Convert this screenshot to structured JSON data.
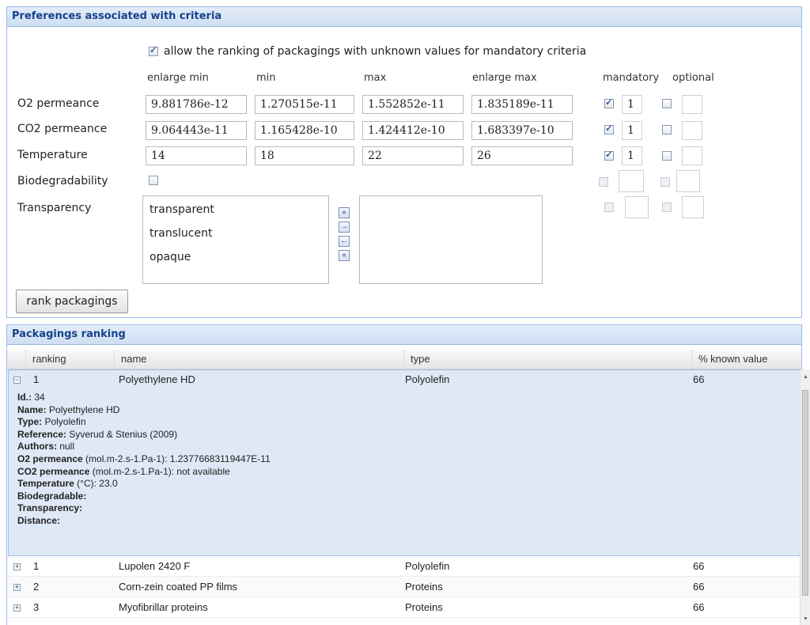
{
  "prefs": {
    "title": "Preferences associated with criteria",
    "allow_label": "allow the ranking of packagings with unknown values for mandatory criteria",
    "col_headers": [
      "enlarge min",
      "min",
      "max",
      "enlarge max",
      "mandatory",
      "optional"
    ],
    "rows": [
      {
        "label": "O2 permeance",
        "values": [
          "9.881786e-12",
          "1.270515e-11",
          "1.552852e-11",
          "1.835189e-11"
        ],
        "mandatory_checked": true,
        "mandatory_weight": "1",
        "optional_checked": false
      },
      {
        "label": "CO2 permeance",
        "values": [
          "9.064443e-11",
          "1.165428e-10",
          "1.424412e-10",
          "1.683397e-10"
        ],
        "mandatory_checked": true,
        "mandatory_weight": "1",
        "optional_checked": false
      },
      {
        "label": "Temperature",
        "values": [
          "14",
          "18",
          "22",
          "26"
        ],
        "mandatory_checked": true,
        "mandatory_weight": "1",
        "optional_checked": false
      }
    ],
    "biodegradability_label": "Biodegradability",
    "transparency_label": "Transparency",
    "transparency_options": [
      "transparent",
      "translucent",
      "opaque"
    ],
    "rank_button": "rank packagings"
  },
  "ranking": {
    "title": "Packagings ranking",
    "headers": [
      "ranking",
      "name",
      "type",
      "% known value"
    ],
    "expanded": {
      "rank": "1",
      "name": "Polyethylene HD",
      "type": "Polyolefin",
      "known": "66",
      "details": [
        {
          "k": "Id.:",
          "v": " 34"
        },
        {
          "k": "Name:",
          "v": " Polyethylene HD"
        },
        {
          "k": "Type:",
          "v": " Polyolefin"
        },
        {
          "k": "Reference:",
          "v": " Syverud & Stenius (2009)"
        },
        {
          "k": "Authors:",
          "v": " null"
        },
        {
          "k": "O2 permeance",
          "v": " (mol.m-2.s-1.Pa-1): 1.23776683119447E-11"
        },
        {
          "k": "CO2 permeance",
          "v": " (mol.m-2.s-1.Pa-1): not available"
        },
        {
          "k": "Temperature",
          "v": " (°C): 23.0"
        },
        {
          "k": "Biodegradable:",
          "v": ""
        },
        {
          "k": "Transparency:",
          "v": ""
        },
        {
          "k": "Distance:",
          "v": ""
        }
      ]
    },
    "rows": [
      {
        "rank": "1",
        "name": "Lupolen 2420 F",
        "type": "Polyolefin",
        "known": "66"
      },
      {
        "rank": "2",
        "name": "Corn-zein coated PP films",
        "type": "Proteins",
        "known": "66"
      },
      {
        "rank": "3",
        "name": "Myofibrillar proteins",
        "type": "Proteins",
        "known": "66"
      }
    ]
  }
}
